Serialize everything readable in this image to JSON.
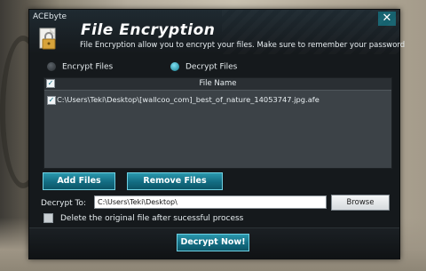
{
  "app": {
    "brand": "ACEbyte",
    "title": "File Encryption",
    "subtitle": "File Encryption allow you to encrypt your files. Make sure to remember your password",
    "close_glyph": "✕"
  },
  "modes": [
    {
      "label": "Encrypt Files",
      "selected": false
    },
    {
      "label": "Decrypt Files",
      "selected": true
    }
  ],
  "file_list": {
    "column_header": "File Name",
    "files": [
      {
        "checked": true,
        "name": "C:\\Users\\Teki\\Desktop\\[wallcoo_com]_best_of_nature_14053747.jpg.afe"
      }
    ]
  },
  "actions": {
    "add_files": "Add Files",
    "remove_files": "Remove Files",
    "browse": "Browse",
    "decrypt_now": "Decrypt Now!"
  },
  "output": {
    "label": "Decrypt To:",
    "path": "C:\\Users\\Teki\\Desktop\\"
  },
  "options": {
    "delete_original_label": "Delete the original file after sucessful process",
    "delete_original_checked": false
  },
  "colors": {
    "accent": "#136c82",
    "window_bg": "#15191c",
    "panel_bg": "#3c4247"
  }
}
